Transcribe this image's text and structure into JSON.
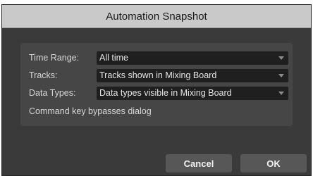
{
  "dialog": {
    "title": "Automation Snapshot",
    "fields": [
      {
        "label": "Time Range:",
        "value": "All time"
      },
      {
        "label": "Tracks:",
        "value": "Tracks shown in Mixing Board"
      },
      {
        "label": "Data Types:",
        "value": "Data types visible in Mixing Board"
      }
    ],
    "hint": "Command key bypasses dialog",
    "cancel_label": "Cancel",
    "ok_label": "OK"
  }
}
